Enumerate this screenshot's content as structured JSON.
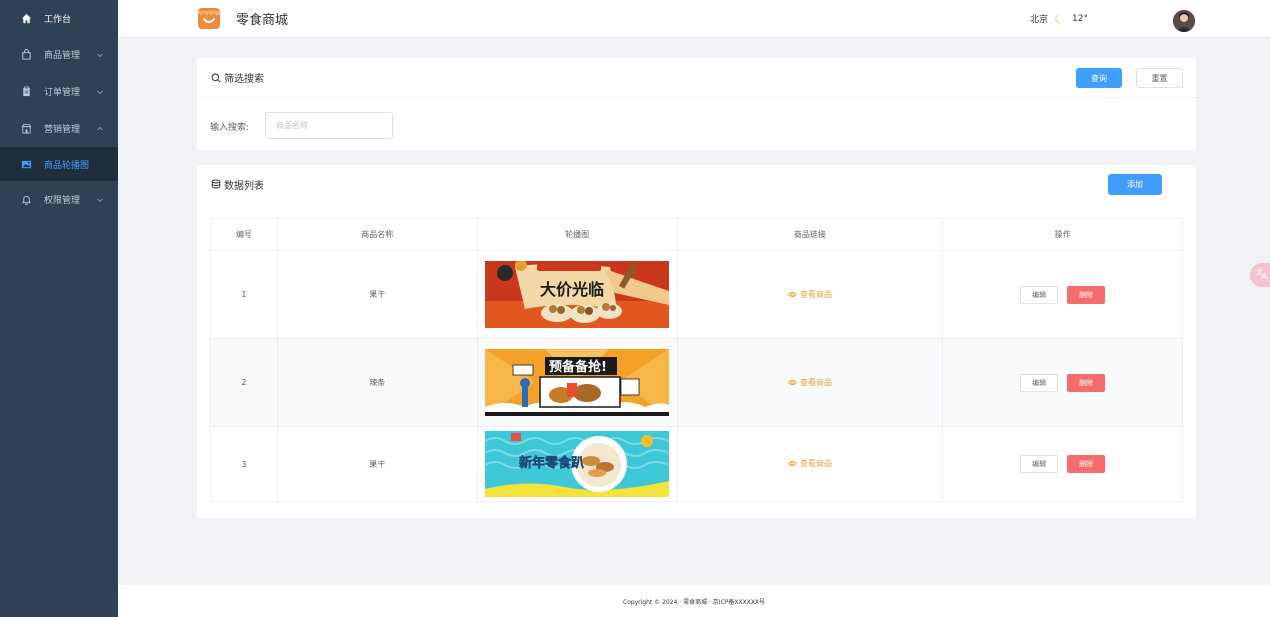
{
  "sidebar": {
    "items": [
      {
        "label": "工作台"
      },
      {
        "label": "商品管理"
      },
      {
        "label": "订单管理"
      },
      {
        "label": "营销管理"
      },
      {
        "label": "商品轮播图"
      },
      {
        "label": "权限管理"
      }
    ]
  },
  "header": {
    "brand": "零食商城",
    "city": "北京",
    "temperature": "12°"
  },
  "filter": {
    "title": "筛选搜索",
    "query_button": "查询",
    "reset_button": "重置",
    "search_label": "输入搜索:",
    "search_placeholder": "商品名称",
    "search_value": ""
  },
  "list": {
    "title": "数据列表",
    "add_button": "添加",
    "columns": [
      "编号",
      "商品名称",
      "轮播图",
      "商品链接",
      "操作"
    ],
    "rows": [
      {
        "id": "1",
        "name": "果干",
        "link": "查看商品",
        "edit": "编辑",
        "delete": "删除",
        "banner_text": "大价光临"
      },
      {
        "id": "2",
        "name": "辣条",
        "link": "查看商品",
        "edit": "编辑",
        "delete": "删除",
        "banner_text": "预备备抢!"
      },
      {
        "id": "3",
        "name": "果干",
        "link": "查看商品",
        "edit": "编辑",
        "delete": "删除",
        "banner_text": "新年零食趴"
      }
    ]
  },
  "footer": {
    "text": "Copyright © 2024 · 零食商城 · 京ICP备XXXXXX号"
  },
  "colors": {
    "sidebar_bg": "#304156",
    "primary": "#409eff",
    "danger": "#f56c6c",
    "link": "#e6a23c"
  }
}
